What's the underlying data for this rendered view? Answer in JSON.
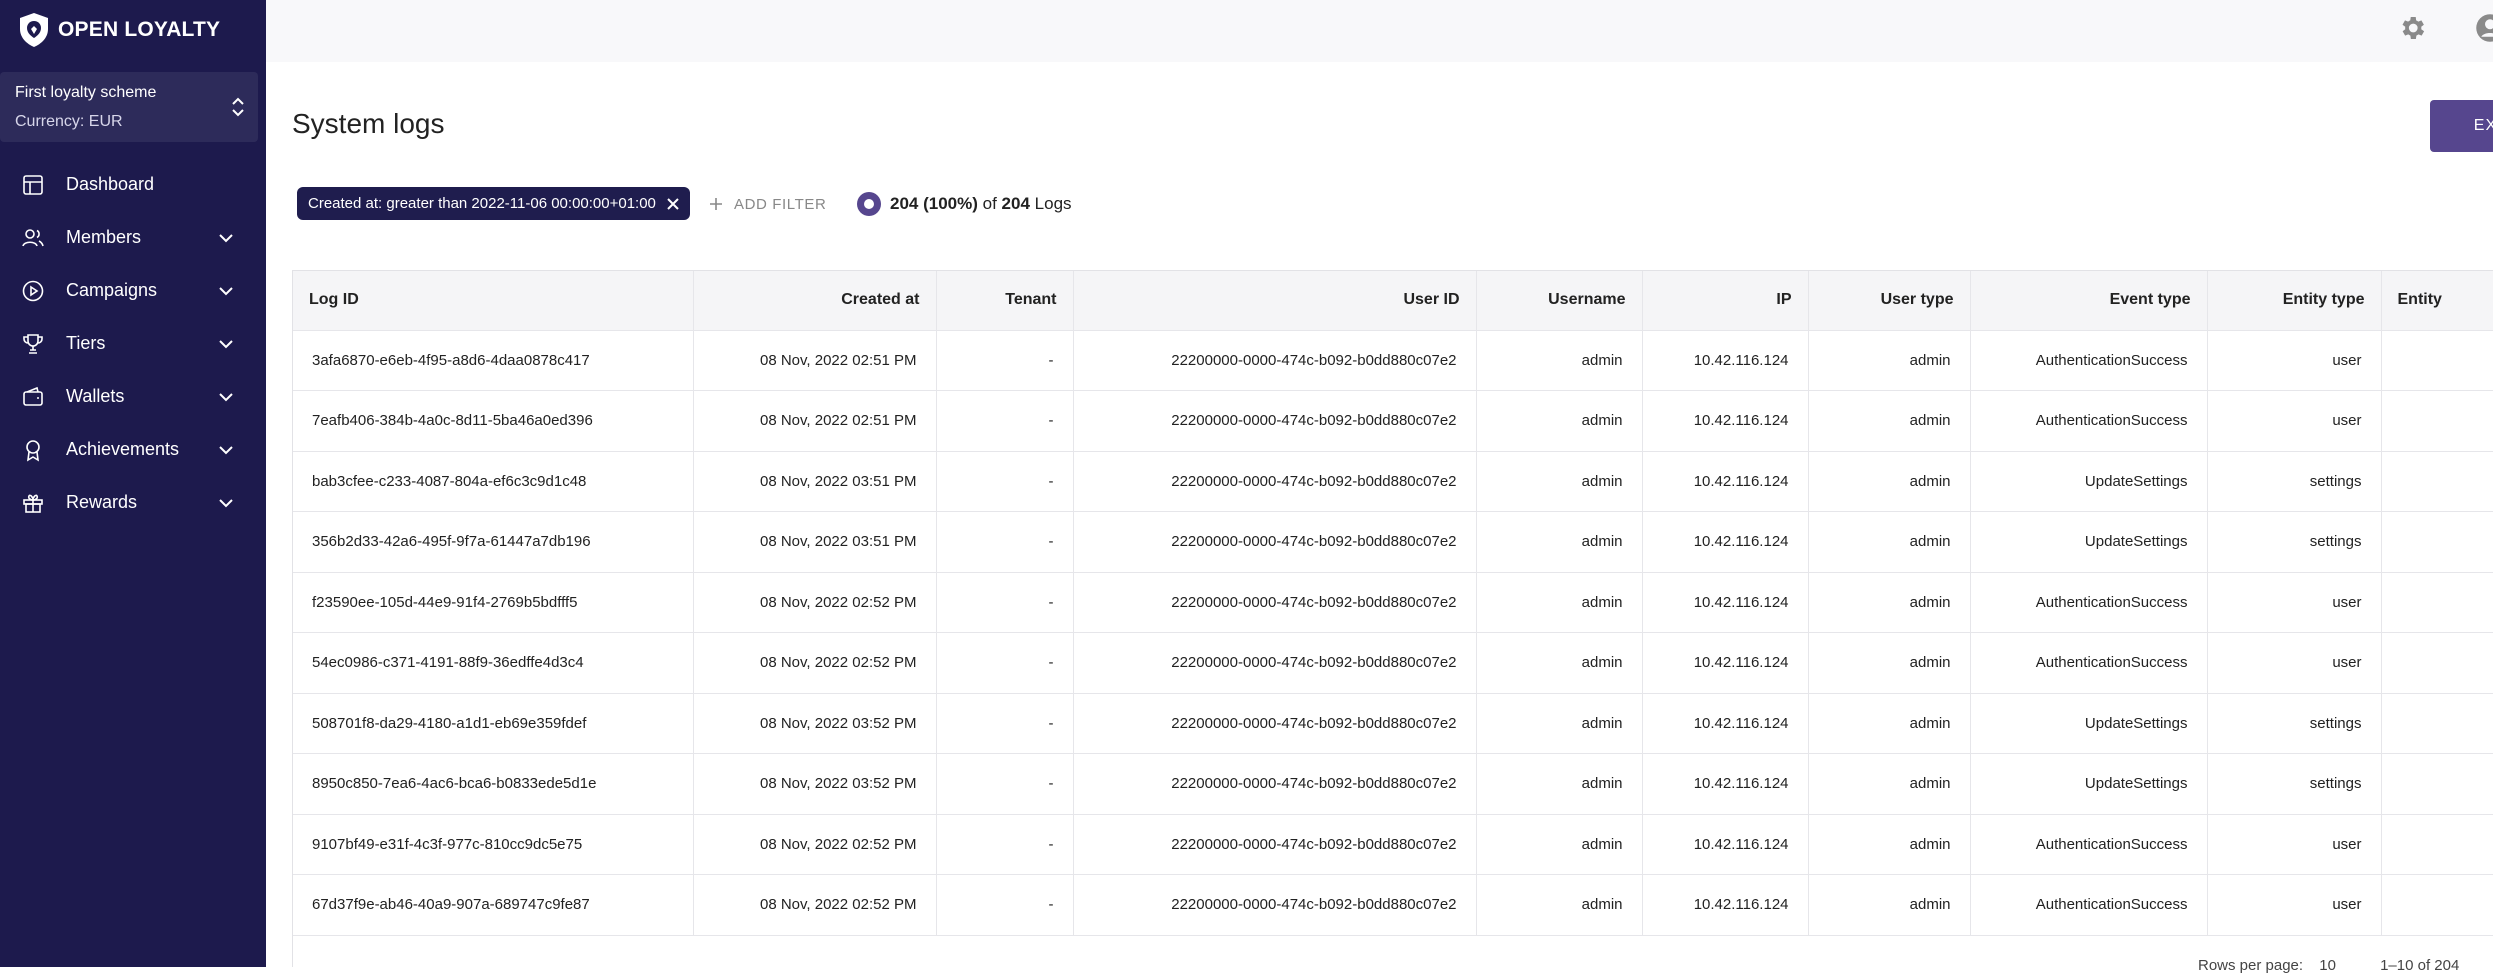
{
  "brand": {
    "name": "OPEN LOYALTY"
  },
  "scheme": {
    "name": "First loyalty scheme",
    "currency": "Currency: EUR"
  },
  "nav": [
    {
      "label": "Dashboard",
      "icon": "dashboard-icon",
      "chevron": false
    },
    {
      "label": "Members",
      "icon": "members-icon",
      "chevron": true
    },
    {
      "label": "Campaigns",
      "icon": "campaigns-icon",
      "chevron": true
    },
    {
      "label": "Tiers",
      "icon": "trophy-icon",
      "chevron": true
    },
    {
      "label": "Wallets",
      "icon": "wallet-icon",
      "chevron": true
    },
    {
      "label": "Achievements",
      "icon": "award-icon",
      "chevron": true
    },
    {
      "label": "Rewards",
      "icon": "gift-icon",
      "chevron": true
    }
  ],
  "page": {
    "title": "System logs",
    "export_label": "EXPO"
  },
  "filters": {
    "active": "Created at: greater than 2022-11-06 00:00:00+01:00",
    "add_label": "ADD FILTER",
    "count_value": "204 (100%)",
    "count_of": "of",
    "count_total": "204",
    "count_unit": "Logs"
  },
  "table": {
    "columns": [
      "Log ID",
      "Created at",
      "Tenant",
      "User ID",
      "Username",
      "IP",
      "User type",
      "Event type",
      "Entity type",
      "Entity"
    ],
    "rows": [
      [
        "3afa6870-e6eb-4f95-a8d6-4daa0878c417",
        "08 Nov, 2022 02:51 PM",
        "-",
        "22200000-0000-474c-b092-b0dd880c07e2",
        "admin",
        "10.42.116.124",
        "admin",
        "AuthenticationSuccess",
        "user",
        ""
      ],
      [
        "7eafb406-384b-4a0c-8d11-5ba46a0ed396",
        "08 Nov, 2022 02:51 PM",
        "-",
        "22200000-0000-474c-b092-b0dd880c07e2",
        "admin",
        "10.42.116.124",
        "admin",
        "AuthenticationSuccess",
        "user",
        ""
      ],
      [
        "bab3cfee-c233-4087-804a-ef6c3c9d1c48",
        "08 Nov, 2022 03:51 PM",
        "-",
        "22200000-0000-474c-b092-b0dd880c07e2",
        "admin",
        "10.42.116.124",
        "admin",
        "UpdateSettings",
        "settings",
        ""
      ],
      [
        "356b2d33-42a6-495f-9f7a-61447a7db196",
        "08 Nov, 2022 03:51 PM",
        "-",
        "22200000-0000-474c-b092-b0dd880c07e2",
        "admin",
        "10.42.116.124",
        "admin",
        "UpdateSettings",
        "settings",
        ""
      ],
      [
        "f23590ee-105d-44e9-91f4-2769b5bdfff5",
        "08 Nov, 2022 02:52 PM",
        "-",
        "22200000-0000-474c-b092-b0dd880c07e2",
        "admin",
        "10.42.116.124",
        "admin",
        "AuthenticationSuccess",
        "user",
        ""
      ],
      [
        "54ec0986-c371-4191-88f9-36edffe4d3c4",
        "08 Nov, 2022 02:52 PM",
        "-",
        "22200000-0000-474c-b092-b0dd880c07e2",
        "admin",
        "10.42.116.124",
        "admin",
        "AuthenticationSuccess",
        "user",
        ""
      ],
      [
        "508701f8-da29-4180-a1d1-eb69e359fdef",
        "08 Nov, 2022 03:52 PM",
        "-",
        "22200000-0000-474c-b092-b0dd880c07e2",
        "admin",
        "10.42.116.124",
        "admin",
        "UpdateSettings",
        "settings",
        ""
      ],
      [
        "8950c850-7ea6-4ac6-bca6-b0833ede5d1e",
        "08 Nov, 2022 03:52 PM",
        "-",
        "22200000-0000-474c-b092-b0dd880c07e2",
        "admin",
        "10.42.116.124",
        "admin",
        "UpdateSettings",
        "settings",
        ""
      ],
      [
        "9107bf49-e31f-4c3f-977c-810cc9dc5e75",
        "08 Nov, 2022 02:52 PM",
        "-",
        "22200000-0000-474c-b092-b0dd880c07e2",
        "admin",
        "10.42.116.124",
        "admin",
        "AuthenticationSuccess",
        "user",
        ""
      ],
      [
        "67d37f9e-ab46-40a9-907a-689747c9fe87",
        "08 Nov, 2022 02:52 PM",
        "-",
        "22200000-0000-474c-b092-b0dd880c07e2",
        "admin",
        "10.42.116.124",
        "admin",
        "AuthenticationSuccess",
        "user",
        ""
      ]
    ]
  },
  "pager": {
    "rows_per_page": "Rows per page:",
    "page_size": "10",
    "range": "1–10 of 204"
  },
  "colors": {
    "sidebar": "#1d1a4d",
    "accent": "#56468e",
    "chip": "#1f1d4e"
  }
}
